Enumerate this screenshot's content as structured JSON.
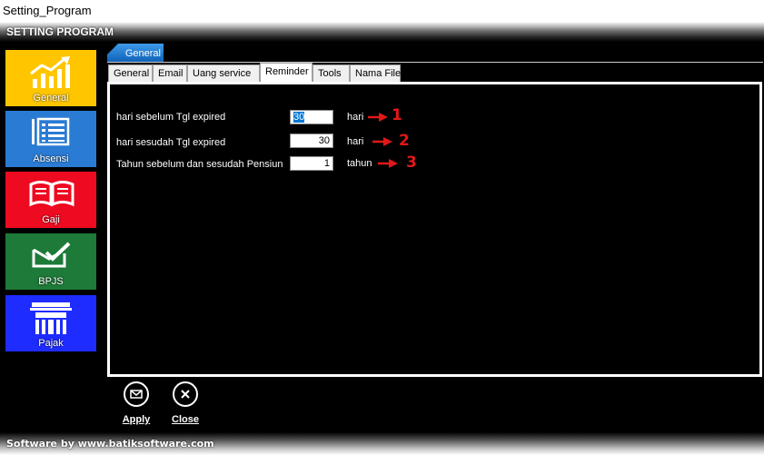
{
  "window": {
    "title": "Setting_Program"
  },
  "header": {
    "title": "SETTING PROGRAM"
  },
  "sidebar": {
    "items": [
      {
        "label": "General",
        "icon": "chart-up-icon",
        "color": "#ffc600"
      },
      {
        "label": "Absensi",
        "icon": "list-icon",
        "color": "#2a7bd4"
      },
      {
        "label": "Gaji",
        "icon": "book-icon",
        "color": "#ee0a20"
      },
      {
        "label": "BPJS",
        "icon": "check-mail-icon",
        "color": "#1d7a38"
      },
      {
        "label": "Pajak",
        "icon": "building-icon",
        "color": "#1e2cff"
      }
    ]
  },
  "group_tab": {
    "label": "General"
  },
  "tabs": [
    {
      "label": "General"
    },
    {
      "label": "Email"
    },
    {
      "label": "Uang service"
    },
    {
      "label": "Reminder",
      "active": true
    },
    {
      "label": "Tools"
    },
    {
      "label": "Nama File"
    }
  ],
  "reminder": {
    "rows": [
      {
        "label": "hari sebelum Tgl expired",
        "value": "30",
        "unit": "hari",
        "marker": "1"
      },
      {
        "label": "hari sesudah Tgl expired",
        "value": "30",
        "unit": "hari",
        "marker": "2"
      },
      {
        "label": "Tahun sebelum dan sesudah Pensiun",
        "value": "1",
        "unit": "tahun",
        "marker": "3"
      }
    ]
  },
  "buttons": {
    "apply_label": "Apply",
    "close_label": "Close"
  },
  "footer": {
    "text": "Software by www.batiksoftware.com"
  },
  "colors": {
    "accent_blue": "#0f62b8",
    "marker_red": "#e01818"
  }
}
